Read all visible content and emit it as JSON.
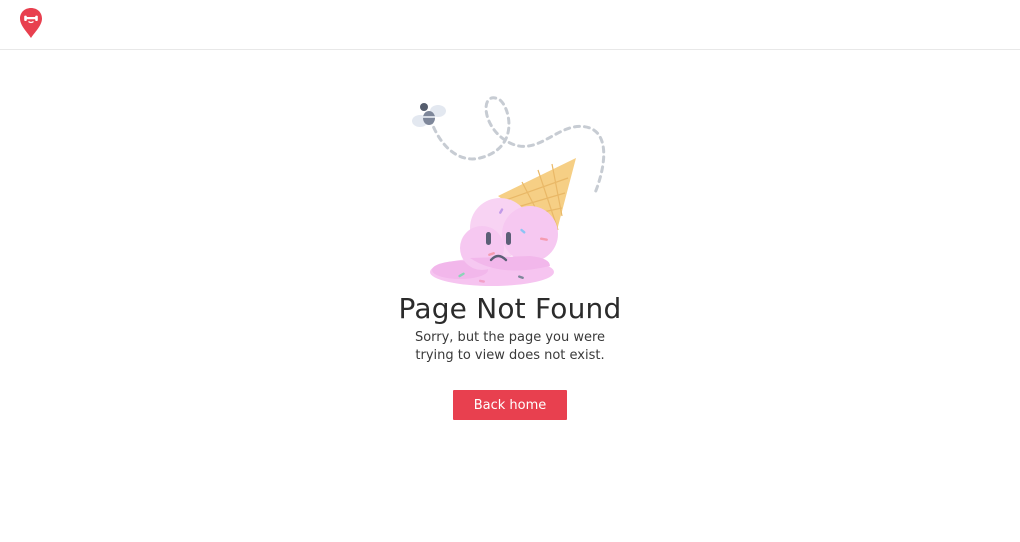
{
  "header": {
    "logo_icon": "location-pin-logo-icon",
    "brand_color": "#e8404f"
  },
  "illustration": {
    "icons": [
      "bee-icon",
      "melted-ice-cream-icon",
      "sad-face-icon"
    ]
  },
  "main": {
    "title": "Page Not Found",
    "message": "Sorry, but the page you were trying to view does not exist.",
    "back_button_label": "Back home"
  }
}
